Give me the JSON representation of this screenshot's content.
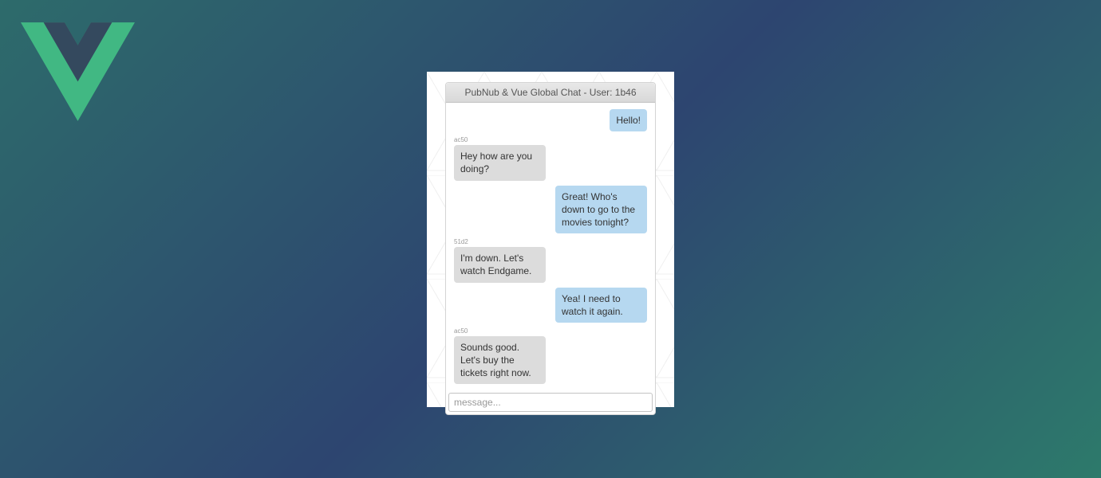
{
  "logo": {
    "name": "vue-logo"
  },
  "chat": {
    "header_title": "PubNub & Vue Global Chat - User: 1b46",
    "input_placeholder": "message...",
    "colors": {
      "mine_bubble": "#b6d8f0",
      "theirs_bubble": "#dcdcdc"
    },
    "messages": [
      {
        "side": "right",
        "sender": "",
        "text": "Hello!"
      },
      {
        "side": "left",
        "sender": "ac50",
        "text": "Hey how are you doing?"
      },
      {
        "side": "right",
        "sender": "",
        "text": "Great! Who's down to go to the movies tonight?"
      },
      {
        "side": "left",
        "sender": "51d2",
        "text": "I'm down. Let's watch Endgame."
      },
      {
        "side": "right",
        "sender": "",
        "text": "Yea! I need to watch it again."
      },
      {
        "side": "left",
        "sender": "ac50",
        "text": "Sounds good. Let's buy the tickets right now."
      }
    ]
  }
}
